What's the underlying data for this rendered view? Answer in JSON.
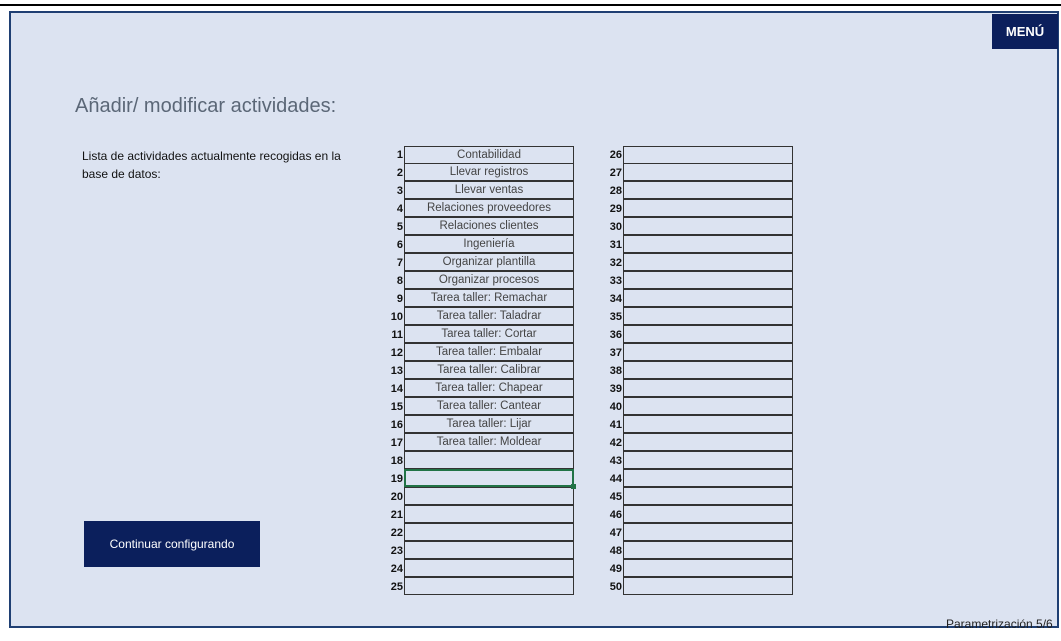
{
  "menu_label": "MENÚ",
  "title": "Añadir/ modificar actividades:",
  "description": "Lista de actividades actualmente recogidas en la base de datos:",
  "continue_label": "Continuar configurando",
  "footer": "Parametrización 5/6",
  "selected_row": 19,
  "column1": [
    {
      "n": "1",
      "activity": "Contabilidad"
    },
    {
      "n": "2",
      "activity": "Llevar registros"
    },
    {
      "n": "3",
      "activity": "Llevar ventas"
    },
    {
      "n": "4",
      "activity": "Relaciones proveedores"
    },
    {
      "n": "5",
      "activity": "Relaciones clientes"
    },
    {
      "n": "6",
      "activity": "Ingeniería"
    },
    {
      "n": "7",
      "activity": "Organizar plantilla"
    },
    {
      "n": "8",
      "activity": "Organizar procesos"
    },
    {
      "n": "9",
      "activity": "Tarea taller: Remachar"
    },
    {
      "n": "10",
      "activity": "Tarea taller: Taladrar"
    },
    {
      "n": "11",
      "activity": "Tarea taller: Cortar"
    },
    {
      "n": "12",
      "activity": "Tarea taller: Embalar"
    },
    {
      "n": "13",
      "activity": "Tarea taller: Calibrar"
    },
    {
      "n": "14",
      "activity": "Tarea taller: Chapear"
    },
    {
      "n": "15",
      "activity": "Tarea taller: Cantear"
    },
    {
      "n": "16",
      "activity": "Tarea taller: Lijar"
    },
    {
      "n": "17",
      "activity": "Tarea taller: Moldear"
    },
    {
      "n": "18",
      "activity": ""
    },
    {
      "n": "19",
      "activity": ""
    },
    {
      "n": "20",
      "activity": ""
    },
    {
      "n": "21",
      "activity": ""
    },
    {
      "n": "22",
      "activity": ""
    },
    {
      "n": "23",
      "activity": ""
    },
    {
      "n": "24",
      "activity": ""
    },
    {
      "n": "25",
      "activity": ""
    }
  ],
  "column2": [
    {
      "n": "26",
      "activity": ""
    },
    {
      "n": "27",
      "activity": ""
    },
    {
      "n": "28",
      "activity": ""
    },
    {
      "n": "29",
      "activity": ""
    },
    {
      "n": "30",
      "activity": ""
    },
    {
      "n": "31",
      "activity": ""
    },
    {
      "n": "32",
      "activity": ""
    },
    {
      "n": "33",
      "activity": ""
    },
    {
      "n": "34",
      "activity": ""
    },
    {
      "n": "35",
      "activity": ""
    },
    {
      "n": "36",
      "activity": ""
    },
    {
      "n": "37",
      "activity": ""
    },
    {
      "n": "38",
      "activity": ""
    },
    {
      "n": "39",
      "activity": ""
    },
    {
      "n": "40",
      "activity": ""
    },
    {
      "n": "41",
      "activity": ""
    },
    {
      "n": "42",
      "activity": ""
    },
    {
      "n": "43",
      "activity": ""
    },
    {
      "n": "44",
      "activity": ""
    },
    {
      "n": "45",
      "activity": ""
    },
    {
      "n": "46",
      "activity": ""
    },
    {
      "n": "47",
      "activity": ""
    },
    {
      "n": "48",
      "activity": ""
    },
    {
      "n": "49",
      "activity": ""
    },
    {
      "n": "50",
      "activity": ""
    }
  ]
}
